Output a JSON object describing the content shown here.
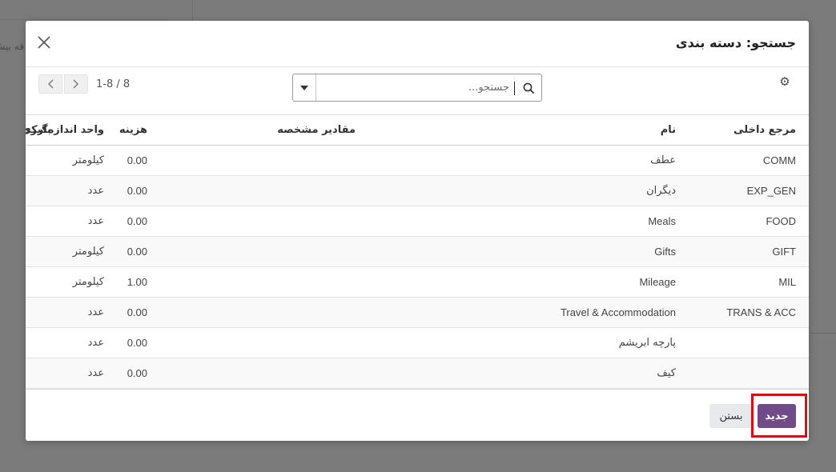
{
  "background": {
    "partial_text": "قه بیش"
  },
  "dialog": {
    "title": "جستجو: دسته بندی",
    "close_icon": "close-icon"
  },
  "toolbar": {
    "settings_icon": "gear-icon",
    "search_placeholder": "جستجو...",
    "search_toggle_icon": "caret-down-icon",
    "search_icon": "magnifier-icon",
    "pager_value": "1-8 / 8",
    "prev_icon": "chevron-left-icon",
    "next_icon": "chevron-right-icon"
  },
  "table": {
    "columns": [
      "مرجع داخلی",
      "نام",
      "مقادیر مشخصه",
      "هزینه",
      "واحد اندازه‌گیری",
      "بارکد"
    ],
    "rows": [
      {
        "ref": "COMM",
        "name": "عطف",
        "attrs": "",
        "cost": "0.00",
        "uom": "کیلومتر",
        "barcode": ""
      },
      {
        "ref": "EXP_GEN",
        "name": "دیگران",
        "attrs": "",
        "cost": "0.00",
        "uom": "عدد",
        "barcode": ""
      },
      {
        "ref": "FOOD",
        "name": "Meals",
        "attrs": "",
        "cost": "0.00",
        "uom": "عدد",
        "barcode": ""
      },
      {
        "ref": "GIFT",
        "name": "Gifts",
        "attrs": "",
        "cost": "0.00",
        "uom": "کیلومتر",
        "barcode": ""
      },
      {
        "ref": "MIL",
        "name": "Mileage",
        "attrs": "",
        "cost": "1.00",
        "uom": "کیلومتر",
        "barcode": ""
      },
      {
        "ref": "TRANS & ACC",
        "name": "Travel & Accommodation",
        "attrs": "",
        "cost": "0.00",
        "uom": "عدد",
        "barcode": ""
      },
      {
        "ref": "",
        "name": "پارچه ابریشم",
        "attrs": "",
        "cost": "0.00",
        "uom": "عدد",
        "barcode": ""
      },
      {
        "ref": "",
        "name": "کیف",
        "attrs": "",
        "cost": "0.00",
        "uom": "عدد",
        "barcode": ""
      }
    ]
  },
  "footer": {
    "new_label": "جدید",
    "close_label": "بستن"
  },
  "colors": {
    "primary": "#714b87",
    "highlight": "#d0121b",
    "overlay": "#7b7b7b"
  }
}
